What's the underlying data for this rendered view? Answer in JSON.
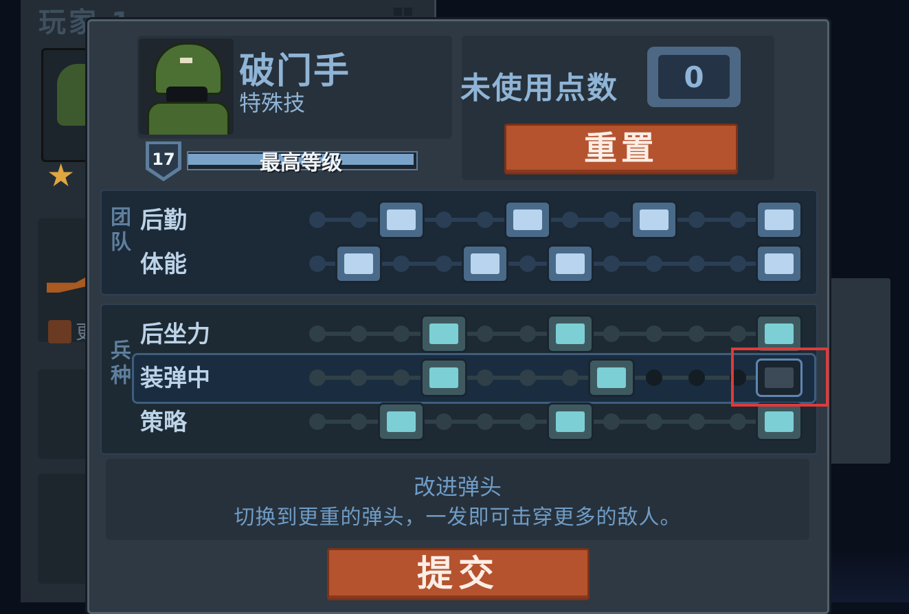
{
  "background_window": {
    "title": "玩家 1",
    "item_text": "更"
  },
  "class": {
    "name": "破门手",
    "subtitle": "特殊技",
    "level": "17",
    "level_text": "最高等级",
    "xp_progress": 1.0
  },
  "points": {
    "label": "未使用点数",
    "value": "0"
  },
  "buttons": {
    "reset": "重置",
    "submit": "提交"
  },
  "categories": {
    "team": "团队",
    "arms": "兵种"
  },
  "skill_rows": [
    {
      "label": "后勤",
      "icons": [
        "ammo-crate-icon",
        "shield-plus-icon",
        "medkit-icon",
        "supply-icon"
      ]
    },
    {
      "label": "体能",
      "icons": [
        "knife-icon",
        "sprint-icon",
        "armor-icon",
        "grenade-icon"
      ]
    },
    {
      "label": "后坐力",
      "icons": [
        "grip-icon",
        "stock-icon",
        "claw-icon"
      ]
    },
    {
      "label": "装弹中",
      "icons": [
        "plus-ammo-icon",
        "magazine-icon",
        "bullet-icon"
      ]
    },
    {
      "label": "策略",
      "icons": [
        "crosshair-icon",
        "lock-icon",
        "blade-icon"
      ]
    }
  ],
  "description": {
    "title": "改进弹头",
    "text": "切换到更重的弹头，一发即可击穿更多的敌人。"
  },
  "colors": {
    "accent_button": "#b4532e",
    "unlocked_icon": "#6fb8be",
    "team_icon": "#8fb4d6",
    "selection_box": "#e03a3a"
  }
}
